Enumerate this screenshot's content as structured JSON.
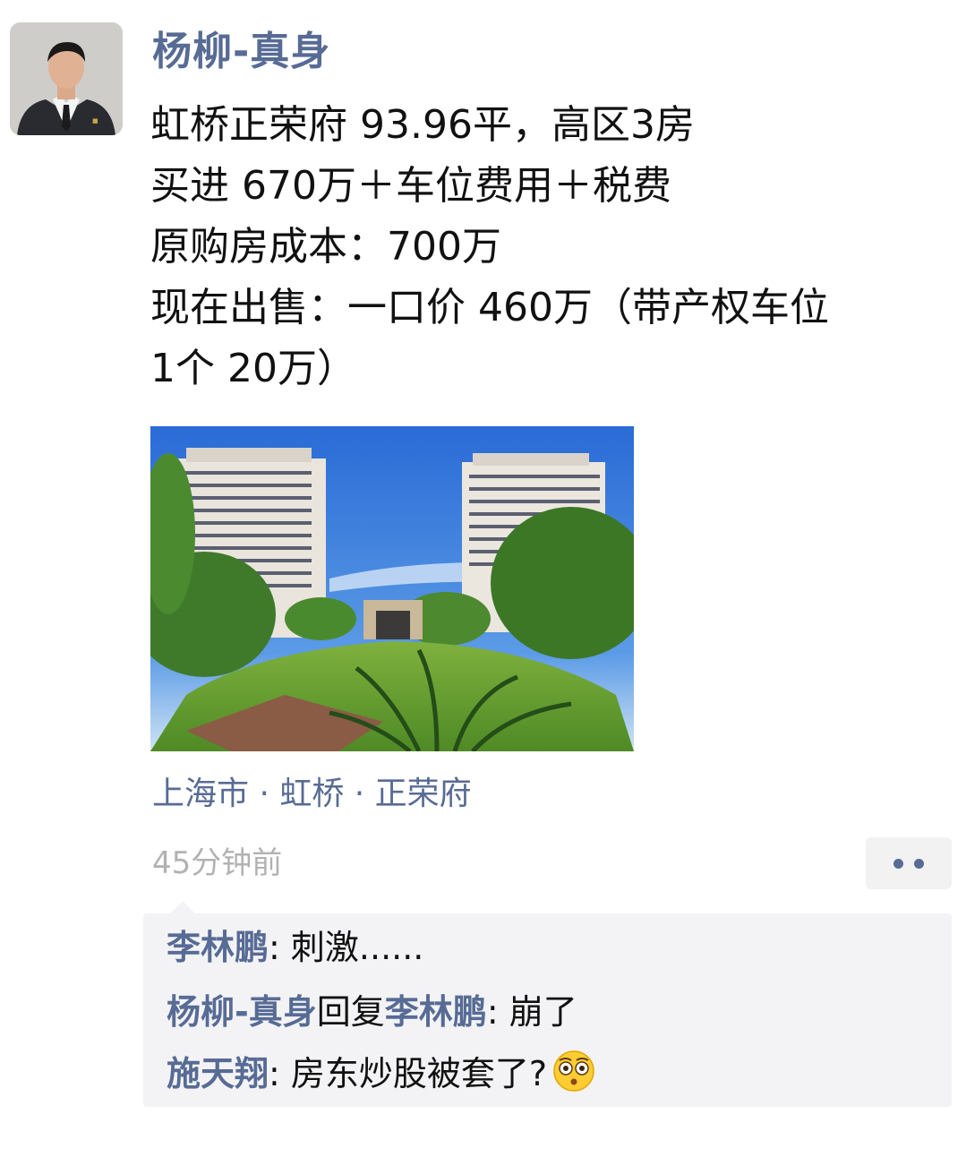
{
  "post": {
    "author": "杨柳-真身",
    "lines": [
      "虹桥正荣府 93.96平，高区3房",
      "买进 670万＋车位费用＋税费",
      "原购房成本：700万",
      "现在出售：一口价 460万（带产权车位",
      "1个 20万）"
    ],
    "location": "上海市 · 虹桥 · 正荣府",
    "time": "45分钟前",
    "more_icon": "two-dots-icon"
  },
  "comments": [
    {
      "author": "李林鹏",
      "sep": ": ",
      "text": "刺激......"
    },
    {
      "author": "杨柳-真身",
      "reply_word": "回复",
      "reply_to": "李林鹏",
      "sep": ": ",
      "text": "崩了"
    },
    {
      "author": "施天翔",
      "sep": ": ",
      "text": "房东炒股被套了?",
      "emoji": "flushed-face-emoji"
    }
  ],
  "colors": {
    "link": "#576b95",
    "text": "#111111",
    "meta": "#b2b2b2",
    "comment_bg": "#f3f3f5"
  }
}
